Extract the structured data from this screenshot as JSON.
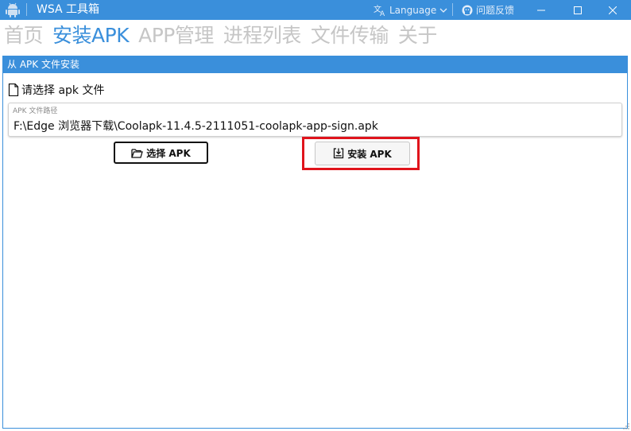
{
  "window": {
    "title": "WSA 工具箱",
    "language_label": "Language",
    "feedback_label": "问题反馈"
  },
  "nav": {
    "tabs": [
      {
        "label": "首页",
        "active": false
      },
      {
        "label": "安装APK",
        "active": true
      },
      {
        "label": "APP管理",
        "active": false
      },
      {
        "label": "进程列表",
        "active": false
      },
      {
        "label": "文件传输",
        "active": false
      },
      {
        "label": "关于",
        "active": false
      }
    ]
  },
  "install_panel": {
    "header": "从 APK 文件安装",
    "choose_title": "请选择 apk 文件",
    "path_label": "APK 文件路径",
    "path_value": "F:\\Edge 浏览器下载\\Coolapk-11.4.5-2111051-coolapk-app-sign.apk",
    "choose_button": "选择 APK",
    "install_button": "安装 APK"
  },
  "colors": {
    "accent": "#3a8fdb",
    "highlight": "#e0141c",
    "inactive_tab": "#c6c6c6"
  }
}
